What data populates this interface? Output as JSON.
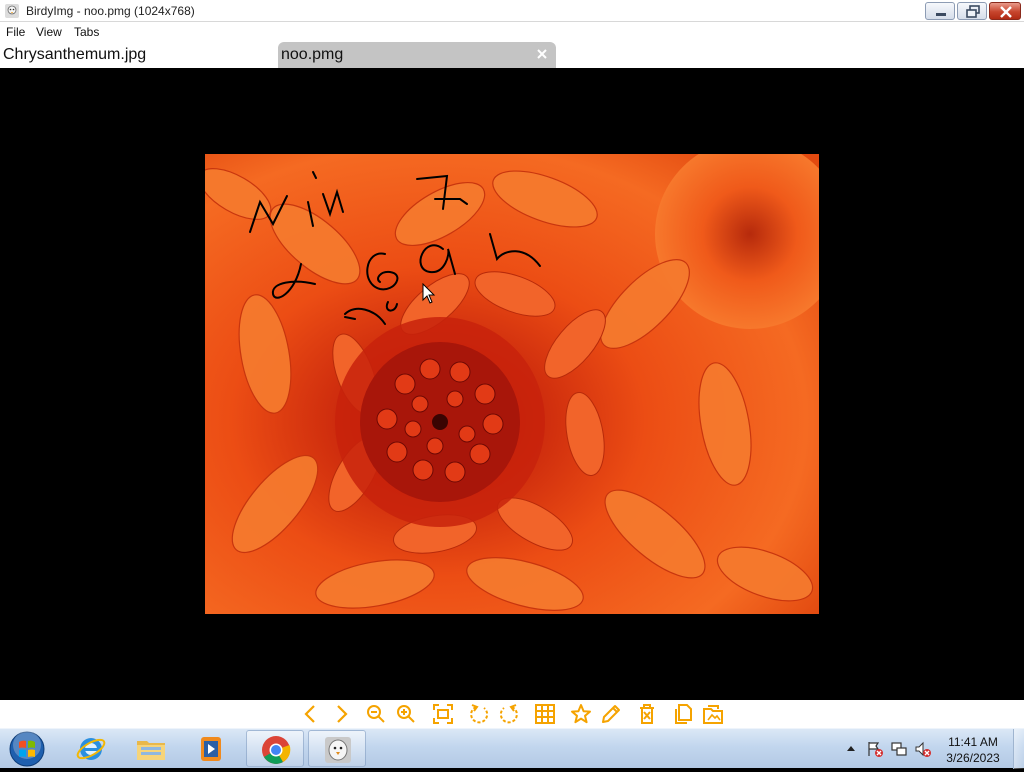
{
  "window": {
    "title": "BirdyImg - noo.pmg (1024x768)",
    "icon": "bird-app-icon",
    "controls": [
      "minimize-icon",
      "restore-icon",
      "close-icon"
    ]
  },
  "menu": {
    "items": [
      {
        "label": "File"
      },
      {
        "label": "View"
      },
      {
        "label": "Tabs"
      }
    ]
  },
  "tabs": [
    {
      "label": "Chrysanthemum.jpg",
      "active": false
    },
    {
      "label": "noo.pmg",
      "active": true,
      "close_icon": "close-x-icon"
    }
  ],
  "viewer": {
    "background": "#000000",
    "image_subject": "orange chrysanthemum flower with black ink scribbles"
  },
  "toolbar": {
    "accent": "#f5a300",
    "tools": [
      {
        "name": "previous-icon"
      },
      {
        "name": "next-icon"
      },
      {
        "name": "zoom-out-icon"
      },
      {
        "name": "zoom-in-icon"
      },
      {
        "name": "fit-to-window-icon"
      },
      {
        "name": "rotate-left-icon"
      },
      {
        "name": "rotate-right-icon"
      },
      {
        "name": "grid-icon"
      },
      {
        "name": "favorite-star-icon"
      },
      {
        "name": "edit-pencil-icon"
      },
      {
        "name": "delete-icon"
      },
      {
        "name": "copy-icon"
      },
      {
        "name": "move-to-folder-icon"
      }
    ]
  },
  "taskbar": {
    "start_icon": "windows-start-icon",
    "apps": [
      {
        "name": "internet-explorer-icon",
        "pinned": false
      },
      {
        "name": "file-explorer-icon",
        "pinned": false
      },
      {
        "name": "media-player-icon",
        "pinned": false
      },
      {
        "name": "chrome-icon",
        "pinned": true
      },
      {
        "name": "birdyimg-icon",
        "pinned": true
      }
    ],
    "tray": [
      "show-hidden-icons-arrow",
      "action-center-flag-icon",
      "network-icon",
      "volume-muted-icon"
    ],
    "clock": {
      "time": "11:41 AM",
      "date": "3/26/2023"
    }
  }
}
